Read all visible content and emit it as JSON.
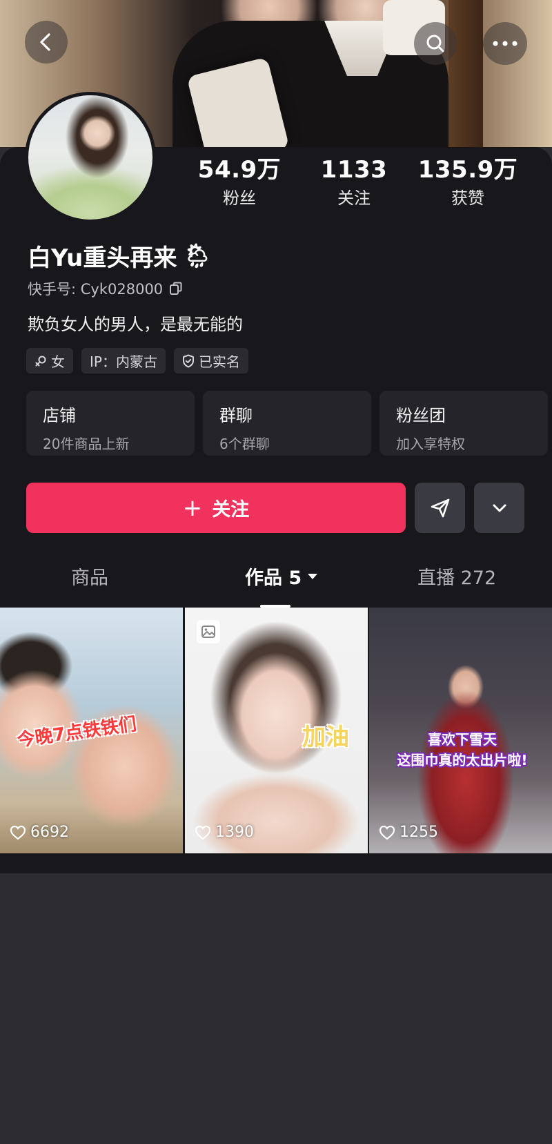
{
  "header": {
    "back_icon": "chevron-left-icon",
    "search_icon": "search-icon",
    "more_icon": "more-dots-icon"
  },
  "stats": {
    "fans": {
      "value": "54.9万",
      "label": "粉丝"
    },
    "following": {
      "value": "1133",
      "label": "关注"
    },
    "likes": {
      "value": "135.9万",
      "label": "获赞"
    }
  },
  "profile": {
    "name": "白Yu重头再来",
    "name_emoji": "🌦",
    "ks_id": "快手号: Cyk028000",
    "bio": "欺负女人的男人，是最无能的"
  },
  "tags": [
    {
      "icon": "female-icon",
      "label": "女"
    },
    {
      "label": "IP：内蒙古"
    },
    {
      "icon": "shield-check-icon",
      "label": "已实名"
    }
  ],
  "cards": [
    {
      "title": "店铺",
      "subtitle": "20件商品上新"
    },
    {
      "title": "群聊",
      "subtitle": "6个群聊"
    },
    {
      "title": "粉丝团",
      "subtitle": "加入享特权"
    }
  ],
  "actions": {
    "follow_label": "关注",
    "follow_plus": "+",
    "share_icon": "send-icon",
    "dropdown_icon": "chevron-down-icon"
  },
  "tabs": {
    "goods": "商品",
    "works": "作品 5",
    "live": "直播 272",
    "active": "works"
  },
  "videos": [
    {
      "caption": "今晚7点铁铁们",
      "likes": "6692"
    },
    {
      "caption": "加油",
      "likes": "1390",
      "badge": "image-icon"
    },
    {
      "caption_line1": "喜欢下雪天",
      "caption_line2": "这围巾真的太出片啦!",
      "likes": "1255"
    }
  ],
  "colors": {
    "accent": "#f1325d",
    "panel": "#17171c",
    "background": "#2c2c32"
  }
}
